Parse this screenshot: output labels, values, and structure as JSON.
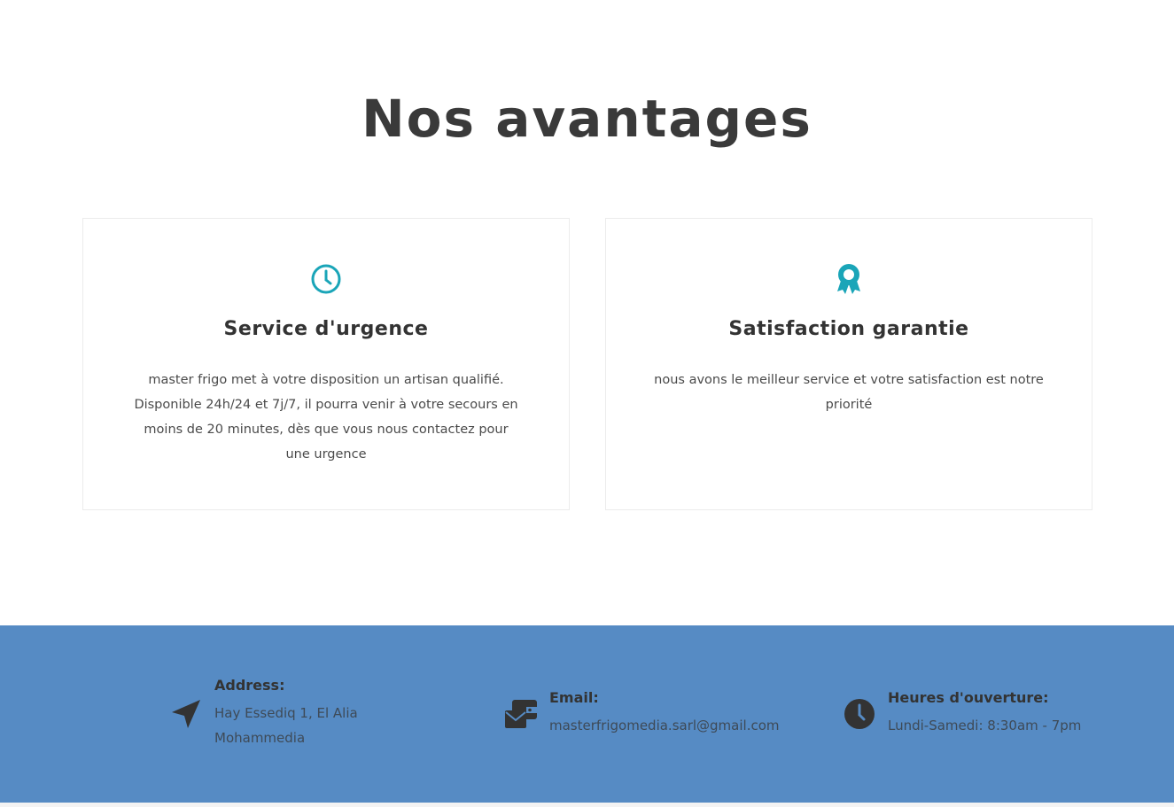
{
  "section": {
    "title": "Nos avantages"
  },
  "cards": [
    {
      "icon": "clock-icon",
      "title": "Service d'urgence",
      "text": "master frigo met à votre disposition un artisan qualifié. Disponible 24h/24 et 7j/7, il pourra venir à votre secours en moins de 20 minutes, dès que vous nous contactez pour une urgence"
    },
    {
      "icon": "award-ribbon-icon",
      "title": "Satisfaction garantie",
      "text": "nous avons le meilleur service et votre satisfaction est notre priorité"
    }
  ],
  "footer": {
    "address": {
      "icon": "location-arrow-icon",
      "label": "Address:",
      "line1": "Hay Essediq 1, El Alia",
      "line2": "Mohammedia"
    },
    "email": {
      "icon": "envelope-wallet-icon",
      "label": "Email:",
      "value": "masterfrigomedia.sarl@gmail.com"
    },
    "hours": {
      "icon": "clock-filled-icon",
      "label": "Heures d'ouverture:",
      "value": "Lundi-Samedi: 8:30am - 7pm"
    }
  },
  "colors": {
    "accent": "#1aa5b8",
    "footer_bg": "#568bc4",
    "text_dark": "#333333"
  }
}
